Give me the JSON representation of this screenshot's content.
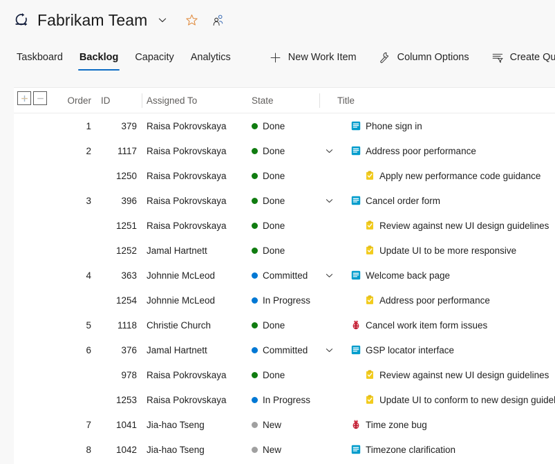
{
  "header": {
    "team_name": "Fabrikam Team",
    "logo_icon": "azure-devops-team-icon",
    "chevron_icon": "chevron-down-icon",
    "favorite_icon": "star-icon",
    "members_icon": "team-members-icon"
  },
  "toolbar": {
    "tabs": [
      {
        "label": "Taskboard",
        "active": false
      },
      {
        "label": "Backlog",
        "active": true
      },
      {
        "label": "Capacity",
        "active": false
      },
      {
        "label": "Analytics",
        "active": false
      }
    ],
    "actions": [
      {
        "label": "New Work Item",
        "icon": "plus-icon"
      },
      {
        "label": "Column Options",
        "icon": "wrench-icon"
      },
      {
        "label": "Create Query",
        "icon": "filter-query-icon"
      }
    ]
  },
  "grid": {
    "expand_all_label": "+",
    "collapse_all_label": "−",
    "expand_all_icon": "plus-icon",
    "collapse_all_icon": "minus-icon",
    "columns": [
      {
        "key": "order",
        "label": "Order"
      },
      {
        "key": "id",
        "label": "ID"
      },
      {
        "key": "assigned_to",
        "label": "Assigned To"
      },
      {
        "key": "state",
        "label": "State"
      },
      {
        "key": "title",
        "label": "Title"
      }
    ],
    "state_colors": {
      "Done": "#107c10",
      "Committed": "#0078d4",
      "In Progress": "#0078d4",
      "New": "#a0a0a0"
    },
    "type_colors": {
      "User Story": "#009ccc",
      "Task": "#f2cb1d",
      "Bug": "#cc293d"
    },
    "rows": [
      {
        "order": "1",
        "id": "379",
        "assigned_to": "Raisa Pokrovskaya",
        "state": "Done",
        "title": "Phone sign in",
        "type": "User Story",
        "indent": 0,
        "expanded": false,
        "has_chevron": false
      },
      {
        "order": "2",
        "id": "1117",
        "assigned_to": "Raisa Pokrovskaya",
        "state": "Done",
        "title": "Address poor performance",
        "type": "User Story",
        "indent": 0,
        "expanded": true,
        "has_chevron": true
      },
      {
        "order": "",
        "id": "1250",
        "assigned_to": "Raisa Pokrovskaya",
        "state": "Done",
        "title": "Apply new performance code guidance",
        "type": "Task",
        "indent": 1,
        "expanded": false,
        "has_chevron": false
      },
      {
        "order": "3",
        "id": "396",
        "assigned_to": "Raisa Pokrovskaya",
        "state": "Done",
        "title": "Cancel order form",
        "type": "User Story",
        "indent": 0,
        "expanded": true,
        "has_chevron": true
      },
      {
        "order": "",
        "id": "1251",
        "assigned_to": "Raisa Pokrovskaya",
        "state": "Done",
        "title": "Review against new UI design guidelines",
        "type": "Task",
        "indent": 1,
        "expanded": false,
        "has_chevron": false
      },
      {
        "order": "",
        "id": "1252",
        "assigned_to": "Jamal Hartnett",
        "state": "Done",
        "title": "Update UI to be more responsive",
        "type": "Task",
        "indent": 1,
        "expanded": false,
        "has_chevron": false
      },
      {
        "order": "4",
        "id": "363",
        "assigned_to": "Johnnie McLeod",
        "state": "Committed",
        "title": "Welcome back page",
        "type": "User Story",
        "indent": 0,
        "expanded": true,
        "has_chevron": true
      },
      {
        "order": "",
        "id": "1254",
        "assigned_to": "Johnnie McLeod",
        "state": "In Progress",
        "title": "Address poor performance",
        "type": "Task",
        "indent": 1,
        "expanded": false,
        "has_chevron": false
      },
      {
        "order": "5",
        "id": "1118",
        "assigned_to": "Christie Church",
        "state": "Done",
        "title": "Cancel work item form issues",
        "type": "Bug",
        "indent": 0,
        "expanded": false,
        "has_chevron": false
      },
      {
        "order": "6",
        "id": "376",
        "assigned_to": "Jamal Hartnett",
        "state": "Committed",
        "title": "GSP locator interface",
        "type": "User Story",
        "indent": 0,
        "expanded": true,
        "has_chevron": true
      },
      {
        "order": "",
        "id": "978",
        "assigned_to": "Raisa Pokrovskaya",
        "state": "Done",
        "title": "Review against new UI design guidelines",
        "type": "Task",
        "indent": 1,
        "expanded": false,
        "has_chevron": false
      },
      {
        "order": "",
        "id": "1253",
        "assigned_to": "Raisa Pokrovskaya",
        "state": "In Progress",
        "title": "Update UI to conform to new design guidelines",
        "type": "Task",
        "indent": 1,
        "expanded": false,
        "has_chevron": false
      },
      {
        "order": "7",
        "id": "1041",
        "assigned_to": "Jia-hao Tseng",
        "state": "New",
        "title": "Time zone bug",
        "type": "Bug",
        "indent": 0,
        "expanded": false,
        "has_chevron": false
      },
      {
        "order": "8",
        "id": "1042",
        "assigned_to": "Jia-hao Tseng",
        "state": "New",
        "title": "Timezone clarification",
        "type": "User Story",
        "indent": 0,
        "expanded": false,
        "has_chevron": false
      }
    ]
  }
}
